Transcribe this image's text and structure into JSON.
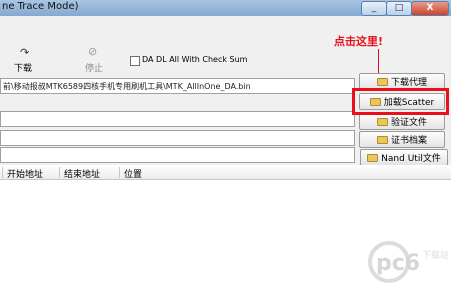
{
  "window": {
    "title": "ne Trace Mode)",
    "minimize_label": "_",
    "maximize_label": "□",
    "close_label": "X"
  },
  "toolbar": {
    "download_label": "下载",
    "stop_label": "停止",
    "checkbox_label": "DA DL All With Check Sum",
    "checkbox_checked": false
  },
  "annotation": {
    "text": "点击这里!",
    "color": "#e8101a"
  },
  "fields": {
    "da_path": "前\\移动报叔MTK6589四核手机专用刷机工具\\MTK_AllInOne_DA.bin",
    "scatter_path": "",
    "auth_path": ""
  },
  "side_buttons": {
    "download_agent": "下载代理",
    "load_scatter": "加载Scatter",
    "auth_file": "验证文件",
    "cert_file": "证书档案",
    "nand_util": "Nand Util文件"
  },
  "table": {
    "columns": [
      "开始地址",
      "结束地址",
      "位置"
    ]
  },
  "watermark": {
    "text": "pc6",
    "subtext": "下载站"
  }
}
